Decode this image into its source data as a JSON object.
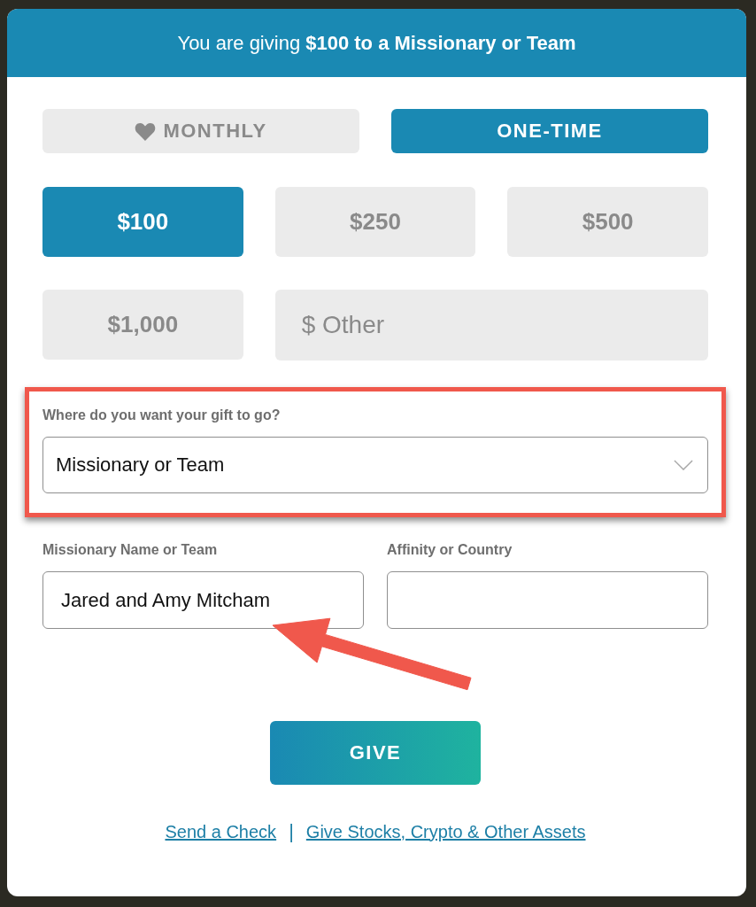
{
  "header": {
    "title": "You are giving **$100 to a Missionary or Team**"
  },
  "frequency_tabs": [
    {
      "label": "MONTHLY",
      "selected": false,
      "icon": true
    },
    {
      "label": "ONE-TIME",
      "selected": true,
      "icon": false
    }
  ],
  "amounts": [
    {
      "label": "$100",
      "selected": true
    },
    {
      "label": "$250",
      "selected": false
    },
    {
      "label": "$500",
      "selected": false
    },
    {
      "label": "$1,000",
      "selected": false
    }
  ],
  "other_amount": {
    "placeholder": "$ Other"
  },
  "destination": {
    "label": "Where do you want your gift to go?",
    "value": "Missionary or Team",
    "highlighted": true
  },
  "fields": [
    {
      "label": "Missionary Name or Team",
      "value": "Jared and Amy Mitcham"
    },
    {
      "label": "Affinity or Country"
    }
  ],
  "pointer_arrow": true,
  "submit": {
    "label": "GIVE"
  },
  "links": [
    {
      "label": "Send a Check"
    },
    {
      "label": "Give Stocks, Crypto & Other Assets"
    }
  ],
  "links_separator": "|"
}
